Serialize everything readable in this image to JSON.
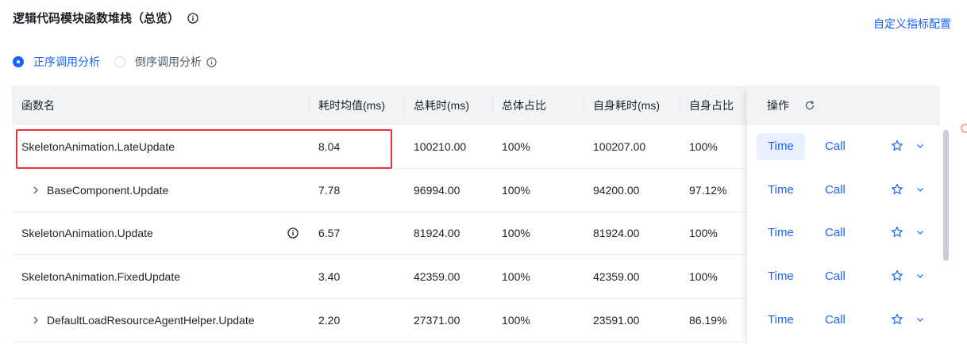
{
  "header": {
    "title": "逻辑代码模块函数堆栈（总览）",
    "info_icon": "info-circle-icon",
    "custom_metrics_link": "自定义指标配置"
  },
  "analysis_mode": {
    "options": [
      {
        "label": "正序调用分析",
        "checked": true
      },
      {
        "label": "倒序调用分析",
        "checked": false
      }
    ]
  },
  "table": {
    "columns": [
      "函数名",
      "耗时均值(ms)",
      "总耗时(ms)",
      "总体占比",
      "自身耗时(ms)",
      "自身占比"
    ],
    "actions_header": "操作",
    "refresh_icon": "refresh-icon",
    "rows": [
      {
        "name": "SkeletonAnimation.LateUpdate",
        "expandable": false,
        "has_info": false,
        "avg": "8.04",
        "total": "100210.00",
        "total_ratio": "100%",
        "self": "100207.00",
        "self_ratio": "100%",
        "time_label": "Time",
        "call_label": "Call",
        "time_active": true
      },
      {
        "name": "BaseComponent.Update",
        "expandable": true,
        "has_info": false,
        "avg": "7.78",
        "total": "96994.00",
        "total_ratio": "100%",
        "self": "94200.00",
        "self_ratio": "97.12%",
        "time_label": "Time",
        "call_label": "Call",
        "time_active": false
      },
      {
        "name": "SkeletonAnimation.Update",
        "expandable": false,
        "has_info": true,
        "avg": "6.57",
        "total": "81924.00",
        "total_ratio": "100%",
        "self": "81924.00",
        "self_ratio": "100%",
        "time_label": "Time",
        "call_label": "Call",
        "time_active": false
      },
      {
        "name": "SkeletonAnimation.FixedUpdate",
        "expandable": false,
        "has_info": false,
        "avg": "3.40",
        "total": "42359.00",
        "total_ratio": "100%",
        "self": "42359.00",
        "self_ratio": "100%",
        "time_label": "Time",
        "call_label": "Call",
        "time_active": false
      },
      {
        "name": "DefaultLoadResourceAgentHelper.Update",
        "expandable": true,
        "has_info": false,
        "avg": "2.20",
        "total": "27371.00",
        "total_ratio": "100%",
        "self": "23591.00",
        "self_ratio": "86.19%",
        "time_label": "Time",
        "call_label": "Call",
        "time_active": false
      }
    ]
  },
  "colors": {
    "accent": "#1664ff",
    "highlight_border": "#e8333c",
    "header_bg": "#f2f3f5"
  }
}
